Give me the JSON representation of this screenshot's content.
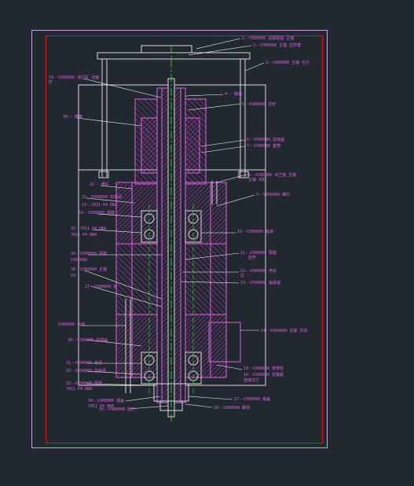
{
  "colors": {
    "background": "#212830",
    "outer_frame": "#c8a0e0",
    "inner_frame": "#d01818",
    "structure": "#e060e0",
    "white_line": "#d8d8d8",
    "hatch": "#c040c0",
    "leader": "#ffffff",
    "center_line": "#20d020",
    "label": "#e060e0"
  },
  "labels": {
    "l1": "1--V300000 总装配图 主轴",
    "l2": "2--V300000 主轴 拉杆套",
    "l3": "3--V300000 主轴 拉爪",
    "l4": "4-- 销轴",
    "l5": "5--V300000 拉杆",
    "l6": "6--V300000 前端盖",
    "l7": "7--V300000 套筒",
    "l8": "8--V300000 法兰盘 主轴",
    "l8b": "主轴 4块",
    "l9": "9--V300000 螺钉",
    "l10": "10--V300000 轴承",
    "l11": "11--V300000 隔套",
    "l11b": "拉杆",
    "l12": "12--V300000 壳体",
    "l12b": "拉",
    "l13": "13--V300000 轴承座",
    "l14": "14--V300000 主轴 冷却",
    "l15": "15--V300000 皮带轮",
    "l16": "16--V300000 花键套",
    "l16b": "连接法兰",
    "l17": "17--V300000 端盖",
    "l18": "18--V300000 螺母",
    "l19": "19--V300000 液压缸 活塞",
    "l19b": "杆",
    "l20": "20-- 碟簧",
    "l21": "21-- 螺钉",
    "l22": "22--V300000 前轴承",
    "l22b": "",
    "l23": "23--7011 P4 DBA",
    "l24": "24--V300000 隔套",
    "l25": "25--7011 P4 DBA",
    "l26": "26--V300000 隔套",
    "l27": "27--V300000 轴",
    "l28": "28--V300000 主轴",
    "l29": "29--",
    "l30": "30--V300000 后端盖",
    "l31": "31--V300000 锁紧",
    "l32": "32--V300000 后轴承",
    "l33": "33--V300000 隔套",
    "l34": "34--V300000 端盖",
    "l35": "35--V300000 拉杆",
    "l36": "36--V300000 螺母",
    "l37": "7011 P4 DBA",
    "l38": "7011 P4 DBA",
    "l39": "V300000",
    "l40": "V300000 壳体",
    "l41": "7011 P4 DBA",
    "l42": "V300000 轴承"
  }
}
